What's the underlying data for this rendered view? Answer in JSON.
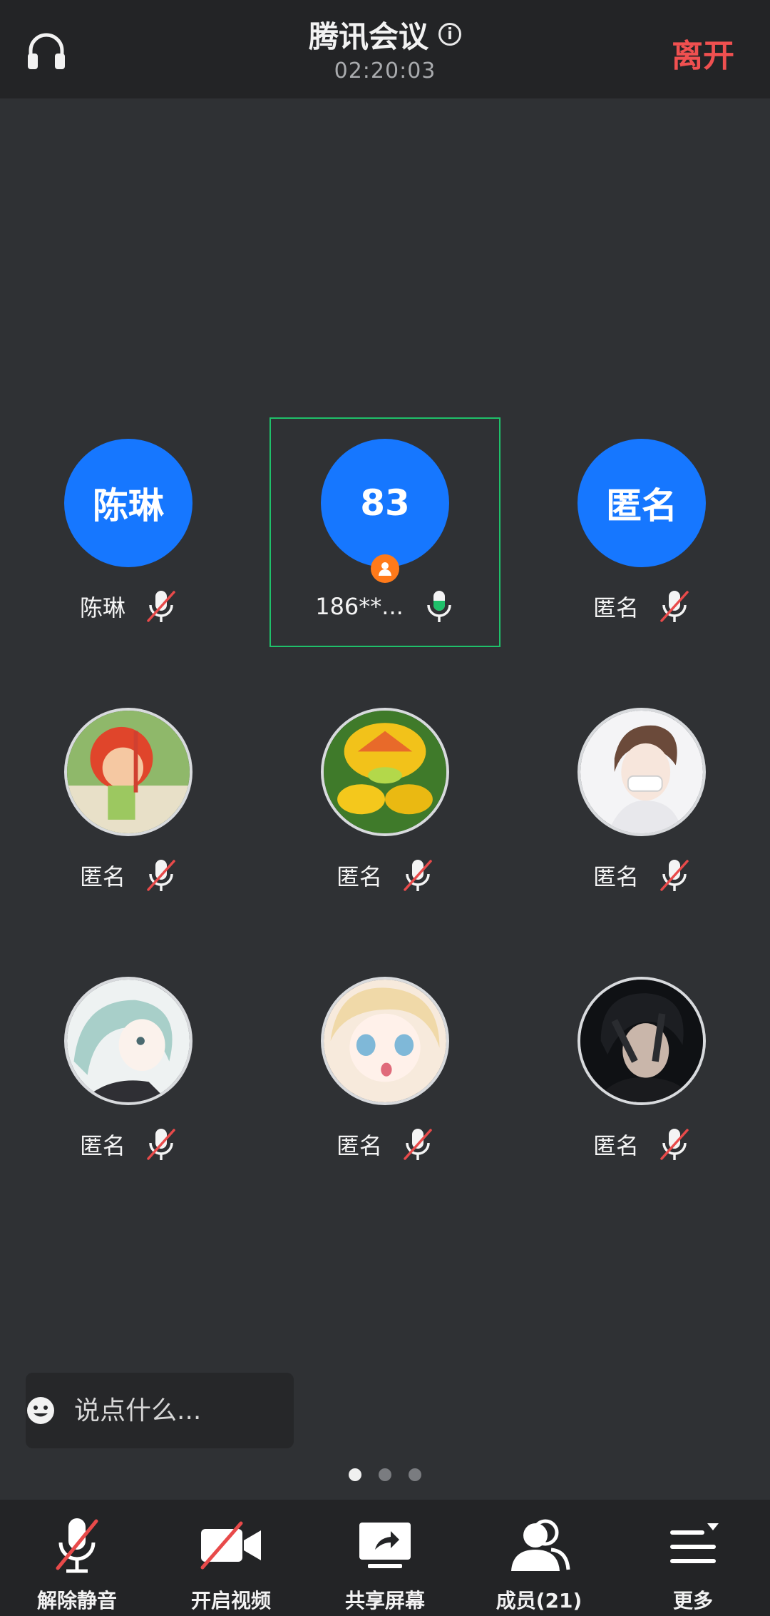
{
  "header": {
    "title": "腾讯会议",
    "timer": "02:20:03",
    "leave_label": "离开"
  },
  "participants": [
    {
      "avatar_type": "initials",
      "avatar_text": "陈琳",
      "name": "陈琳",
      "mic": "muted"
    },
    {
      "avatar_type": "initials",
      "avatar_text": "83",
      "name": "186**...",
      "mic": "active",
      "host": true
    },
    {
      "avatar_type": "initials",
      "avatar_text": "匿名",
      "name": "匿名",
      "mic": "muted"
    },
    {
      "avatar_type": "photo",
      "avatar_icon": "cartoon-child-avatar-icon",
      "name": "匿名",
      "mic": "muted"
    },
    {
      "avatar_type": "photo",
      "avatar_icon": "fruit-avatar-icon",
      "name": "匿名",
      "mic": "muted"
    },
    {
      "avatar_type": "photo",
      "avatar_icon": "anime-boy-avatar-icon",
      "name": "匿名",
      "mic": "muted"
    },
    {
      "avatar_type": "photo",
      "avatar_icon": "anime-girl-silver-hair-avatar-icon",
      "name": "匿名",
      "mic": "muted"
    },
    {
      "avatar_type": "photo",
      "avatar_icon": "anime-girl-blonde-avatar-icon",
      "name": "匿名",
      "mic": "muted"
    },
    {
      "avatar_type": "photo",
      "avatar_icon": "dark-hair-boy-avatar-icon",
      "name": "匿名",
      "mic": "muted"
    }
  ],
  "chat": {
    "placeholder": "说点什么..."
  },
  "pagination": {
    "pages": 3,
    "current": 1
  },
  "toolbar": {
    "unmute_label": "解除静音",
    "video_label": "开启视频",
    "share_label": "共享屏幕",
    "members_label": "成员(21)",
    "more_label": "更多"
  },
  "colors": {
    "background": "#2f3134",
    "bar": "#232426",
    "avatar_blue": "#1677ff",
    "leave_red": "#f05050",
    "speaking_green": "#1fc06a",
    "mute_red": "#e84a4a",
    "host_orange": "#ff7a1a"
  }
}
